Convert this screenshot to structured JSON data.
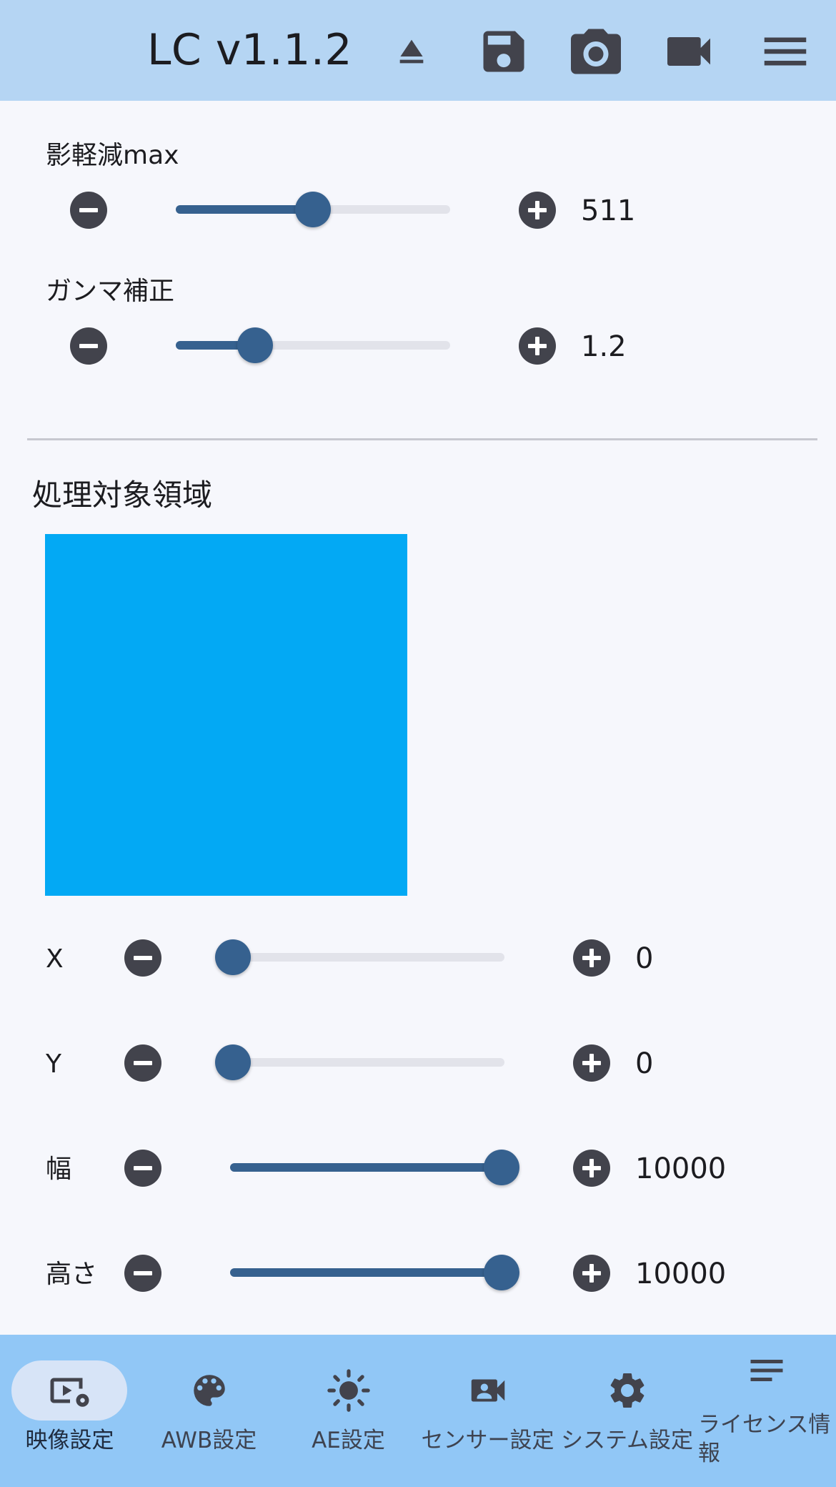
{
  "header": {
    "title": "LC v1.1.2",
    "buttons": [
      "eject-icon",
      "save-icon",
      "camera-icon",
      "videocam-icon",
      "menu-icon"
    ],
    "background": "#b5d5f3"
  },
  "sliders_top": [
    {
      "label": "影軽減max",
      "value_text": "511",
      "fraction": 0.5
    },
    {
      "label": "ガンマ補正",
      "value_text": "1.2",
      "fraction": 0.29
    }
  ],
  "region": {
    "title": "処理対象領域",
    "color": "#03a9f4"
  },
  "sliders_region": [
    {
      "label": "X",
      "value_text": "0",
      "fraction": 0.0
    },
    {
      "label": "Y",
      "value_text": "0",
      "fraction": 0.0
    },
    {
      "label": "幅",
      "value_text": "10000",
      "fraction": 1.0
    },
    {
      "label": "高さ",
      "value_text": "10000",
      "fraction": 1.0
    }
  ],
  "bottom_nav": [
    {
      "label": "映像設定",
      "icon": "video-settings-icon",
      "active": true
    },
    {
      "label": "AWB設定",
      "icon": "palette-icon",
      "active": false
    },
    {
      "label": "AE設定",
      "icon": "brightness-icon",
      "active": false
    },
    {
      "label": "センサー設定",
      "icon": "camera-account-icon",
      "active": false
    },
    {
      "label": "システム設定",
      "icon": "gear-icon",
      "active": false
    },
    {
      "label": "ライセンス情報",
      "icon": "notes-icon",
      "active": false
    }
  ],
  "colors": {
    "accent": "#36618f",
    "button": "#42434c",
    "nav_background": "#91c7f6",
    "nav_active_pill": "#d7e4f7"
  }
}
